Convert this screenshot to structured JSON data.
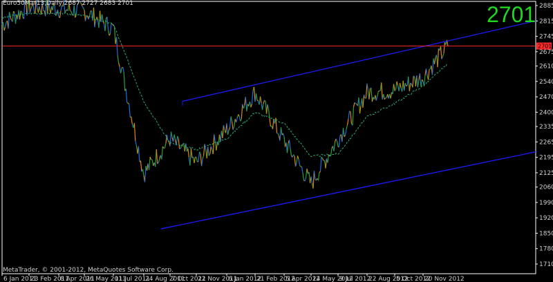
{
  "header": {
    "text": "Euro50Mar13,Daily  2687 2727 2683 2701"
  },
  "price_big": "2701",
  "copyright": "MetaTrader, © 2001-2012, MetaQuotes Software Corp.",
  "colors": {
    "background": "#000000",
    "frame": "#ffffff",
    "price_line": "#ff2a2a",
    "price_tag": "#ff2a2a",
    "channel": "#1b1bff",
    "big_price": "#21d621",
    "ma": "#2aa86f",
    "orange": "#e08a10",
    "blue": "#1e6fe0",
    "green": "#2fa02f"
  },
  "chart_data": {
    "type": "line",
    "title": "",
    "xlabel": "",
    "ylabel": "",
    "x_ticks": [
      "6 Jan 2011",
      "23 Feb 2011",
      "8 Apr 2011",
      "26 May 2011",
      "11 Jul 2011",
      "24 Aug 2011",
      "7 Oct 2011",
      "22 Nov 2011",
      "6 Jan 2012",
      "21 Feb 2012",
      "5 Apr 2012",
      "24 May 2012",
      "9 Jul 2012",
      "22 Aug 2012",
      "5 Oct 2012",
      "20 Nov 2012"
    ],
    "y_ticks": [
      2885,
      2815,
      2745,
      2675,
      2610,
      2540,
      2470,
      2400,
      2335,
      2265,
      2195,
      2125,
      2060,
      1990,
      1920,
      1850,
      1780,
      1710
    ],
    "ylim": [
      1700,
      2900
    ],
    "current_price": 2701,
    "current_price_label": "2701",
    "series": [
      {
        "name": "",
        "x": [
          "6 Jan 2011",
          "23 Feb 2011",
          "8 Apr 2011",
          "26 May 2011",
          "11 Jul 2011",
          "24 Aug 2011",
          "7 Oct 2011",
          "22 Nov 2011",
          "6 Jan 2012",
          "21 Feb 2012",
          "5 Apr 2012",
          "24 May 2012",
          "9 Jul 2012",
          "22 Aug 2012",
          "5 Oct 2012",
          "20 Nov 2012",
          "4 Dec 2012"
        ],
        "values": [
          2800,
          2880,
          2870,
          2860,
          2780,
          2120,
          2280,
          2170,
          2320,
          2490,
          2270,
          2075,
          2280,
          2490,
          2500,
          2560,
          2701
        ]
      },
      {
        "name": "",
        "x": [
          "6 Jan 2011",
          "23 Feb 2011",
          "8 Apr 2011",
          "26 May 2011",
          "11 Jul 2011",
          "24 Aug 2011",
          "7 Oct 2011",
          "22 Nov 2011",
          "6 Jan 2012",
          "21 Feb 2012",
          "5 Apr 2012",
          "24 May 2012",
          "9 Jul 2012",
          "22 Aug 2012",
          "5 Oct 2012",
          "20 Nov 2012",
          "4 Dec 2012"
        ],
        "values": [
          2830,
          2850,
          2850,
          2840,
          2800,
          2450,
          2260,
          2230,
          2280,
          2400,
          2350,
          2200,
          2210,
          2380,
          2440,
          2520,
          2620
        ]
      }
    ],
    "trendlines": [
      {
        "name": "",
        "from": [
          "7 Oct 2011",
          2450
        ],
        "to": [
          "4 Dec 2012+",
          2815
        ]
      },
      {
        "name": "",
        "from": [
          "24 Aug 2011",
          1870
        ],
        "to": [
          "4 Dec 2012+",
          2220
        ]
      }
    ]
  }
}
